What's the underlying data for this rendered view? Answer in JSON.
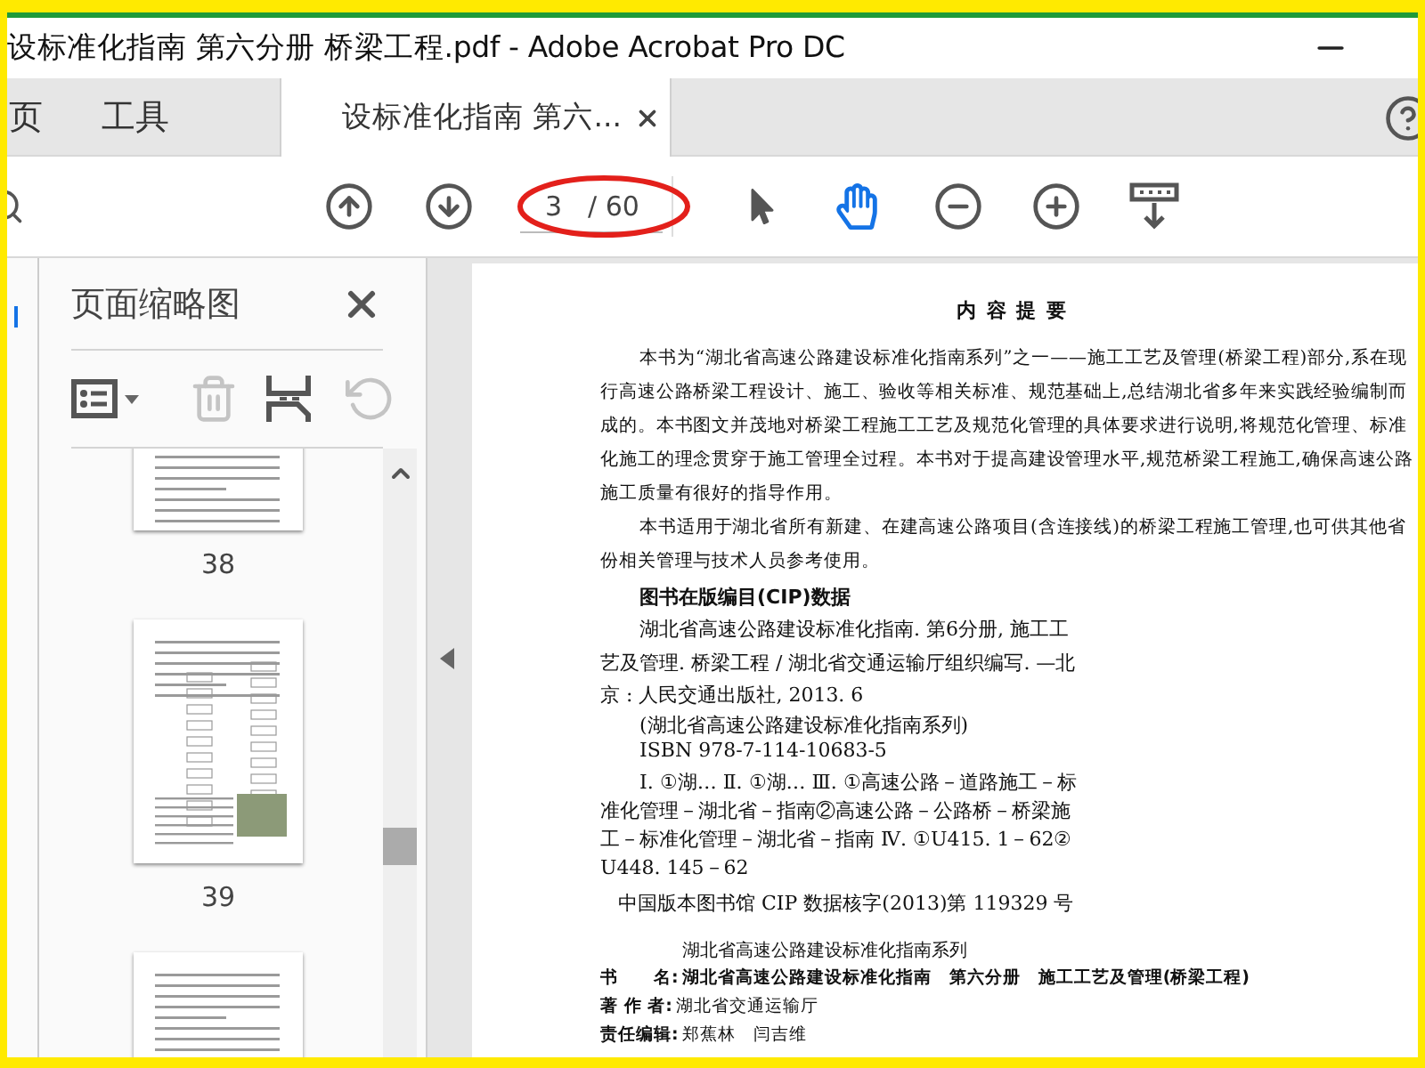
{
  "window": {
    "title": "设标准化指南 第六分册 桥梁工程.pdf - Adobe Acrobat Pro DC"
  },
  "tabs": [
    {
      "label": "页",
      "selected": false,
      "closable": false
    },
    {
      "label": "工具",
      "selected": false,
      "closable": false
    },
    {
      "label": "设标准化指南 第六...",
      "selected": true,
      "closable": true
    }
  ],
  "toolbar": {
    "page_field": {
      "value": "3",
      "total": "/ 60"
    },
    "tools": [
      {
        "kind": "select",
        "selected": false
      },
      {
        "kind": "hand",
        "selected": true
      }
    ]
  },
  "sidebar": {
    "title": "页面缩略图",
    "actions": [
      {
        "kind": "delete",
        "disabled": true
      },
      {
        "kind": "extract",
        "disabled": false
      },
      {
        "kind": "rotate",
        "disabled": true
      }
    ],
    "thumbnails": [
      {
        "kind": "text",
        "page": "38"
      },
      {
        "kind": "figure",
        "page": "39"
      },
      {
        "kind": "text"
      }
    ]
  },
  "document": {
    "heading": "内 容 提 要",
    "paragraphs": [
      "本书为“湖北省高速公路建设标准化指南系列”之一——施工工艺及管理(桥梁工程)部分,系在现行高速公路桥梁工程设计、施工、验收等相关标准、规范基础上,总结湖北省多年来实践经验编制而成的。本书图文并茂地对桥梁工程施工工艺及规范化管理的具体要求进行说明,将规范化管理、标准化施工的理念贯穿于施工管理全过程。本书对于提高建设管理水平,规范桥梁工程施工,确保高速公路施工质量有很好的指导作用。",
      "本书适用于湖北省所有新建、在建高速公路项目(含连接线)的桥梁工程施工管理,也可供其他省份相关管理与技术人员参考使用。"
    ],
    "cip_heading": "图书在版编目(CIP)数据",
    "cip_entry": "湖北省高速公路建设标准化指南. 第6分册, 施工工艺及管理. 桥梁工程 / 湖北省交通运输厅组织编写. —北京 : 人民交通出版社, 2013. 6",
    "cip_series": "(湖北省高速公路建设标准化指南系列)",
    "isbn": "ISBN 978-7-114-10683-5",
    "classification": "Ⅰ. ①湖… Ⅱ. ①湖… Ⅲ. ①高速公路－道路施工－标准化管理－湖北省－指南②高速公路－公路桥－桥梁施工－标准化管理－湖北省－指南 Ⅳ. ①U415. 1－62②U448. 145－62",
    "cip_number": "中国版本图书馆 CIP 数据核字(2013)第 119329 号",
    "series": "湖北省高速公路建设标准化指南系列",
    "credits": [
      {
        "label": "书　　名:",
        "value": "湖北省高速公路建设标准化指南　第六分册　施工工艺及管理(桥梁工程)",
        "bold": true
      },
      {
        "label": "著 作 者:",
        "value": "湖北省交通运输厅",
        "bold": false
      },
      {
        "label": "责任编辑:",
        "value": "郑蕉林　闫吉维",
        "bold": false
      }
    ]
  }
}
